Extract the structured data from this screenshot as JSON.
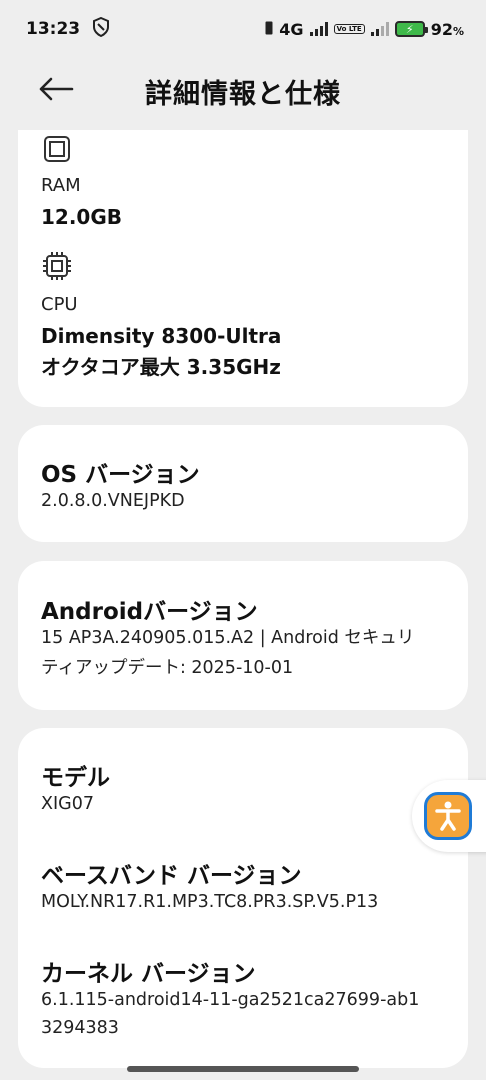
{
  "status": {
    "time": "13:23",
    "network": "4G",
    "volte": "Vo LTE",
    "battery": "92",
    "battery_unit": "%"
  },
  "header": {
    "title": "詳細情報と仕様"
  },
  "specs": {
    "ram_label": "RAM",
    "ram_value": "12.0GB",
    "cpu_label": "CPU",
    "cpu_line1": "Dimensity 8300-Ultra",
    "cpu_line2": "オクタコア最大 3.35GHz"
  },
  "os": {
    "title": "OS バージョン",
    "value": "2.0.8.0.VNEJPKD"
  },
  "android": {
    "title": "Androidバージョン",
    "line1": "15 AP3A.240905.015.A2 | Android セキュリ",
    "line2": "ティアップデート: 2025-10-01"
  },
  "model": {
    "title": "モデル",
    "value": "XIG07"
  },
  "baseband": {
    "title": "ベースバンド バージョン",
    "value": "MOLY.NR17.R1.MP3.TC8.PR3.SP.V5.P13"
  },
  "kernel": {
    "title": "カーネル バージョン",
    "line1": "6.1.115-android14-11-ga2521ca27699-ab1",
    "line2": "3294383"
  },
  "colors": {
    "background": "#eeeeee",
    "card": "#ffffff",
    "accessibility_fill": "#f5a53b",
    "accessibility_border": "#1f7bd6",
    "battery": "#3fb94a"
  }
}
